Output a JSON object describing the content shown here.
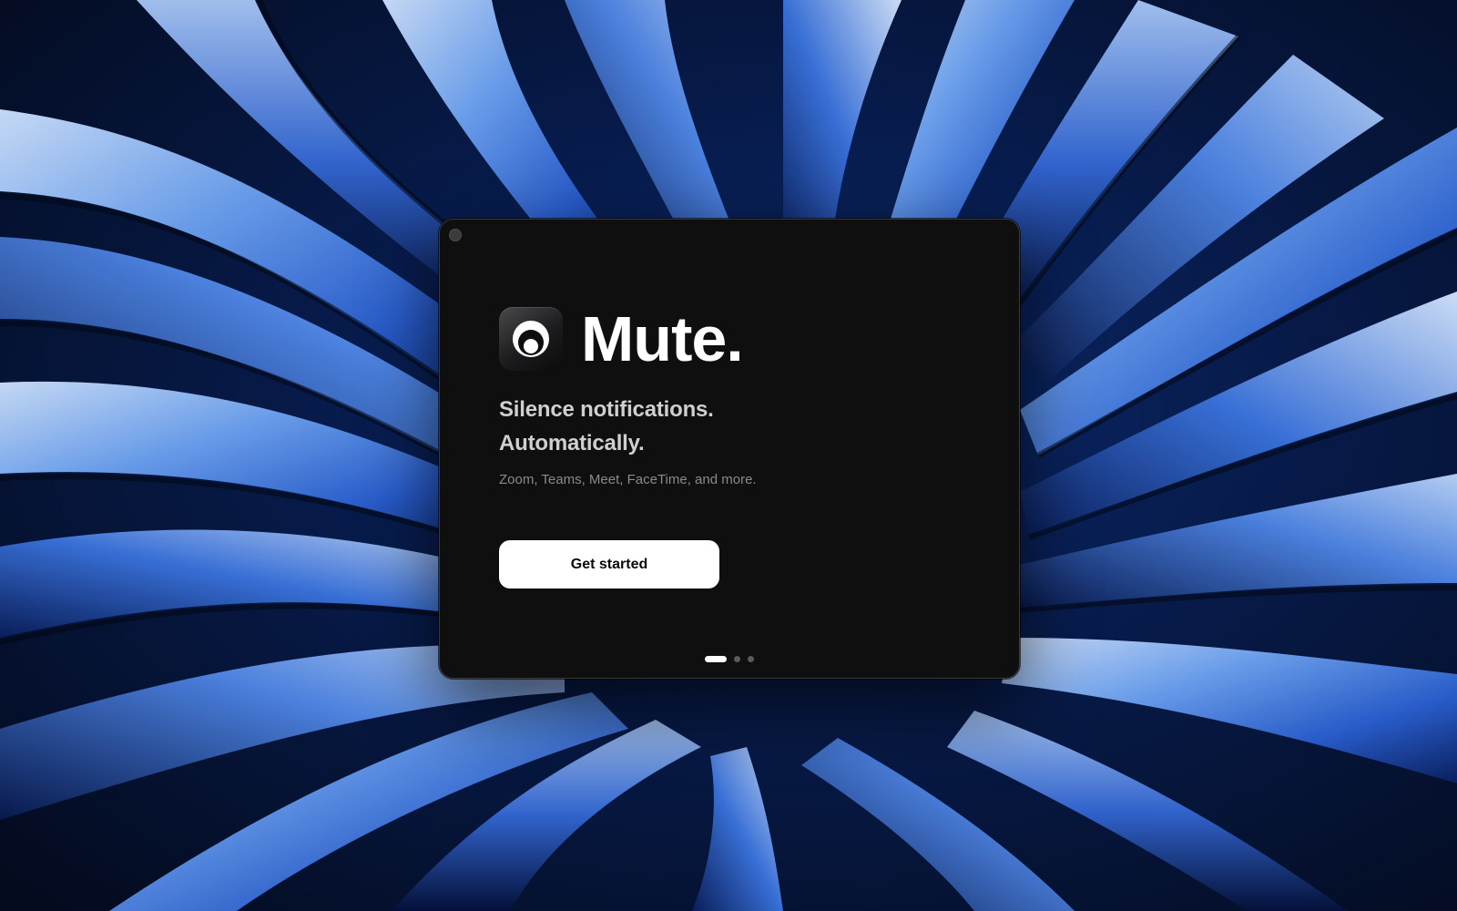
{
  "window": {
    "close_button": "close"
  },
  "app": {
    "icon": "mute-app-icon",
    "name": "Mute."
  },
  "onboarding": {
    "headline_line1": "Silence notifications.",
    "headline_line2": "Automatically.",
    "subtext": "Zoom, Teams, Meet, FaceTime, and more.",
    "cta_label": "Get started",
    "page_count": 3,
    "current_page": 1
  },
  "colors": {
    "window_bg": "#0f0f10",
    "button_bg": "#ffffff",
    "accent_wallpaper": "#2f6ce0"
  }
}
